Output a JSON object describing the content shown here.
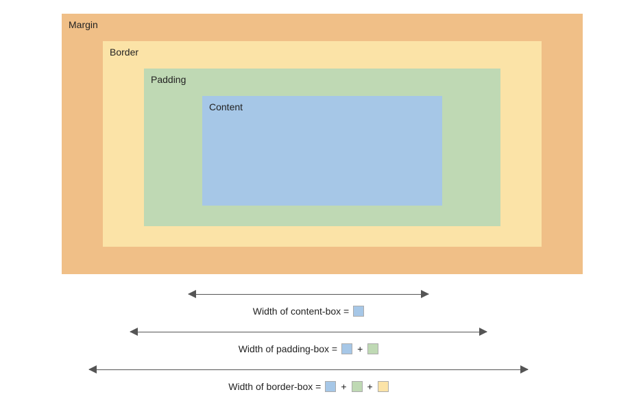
{
  "box_model": {
    "margin_label": "Margin",
    "border_label": "Border",
    "padding_label": "Padding",
    "content_label": "Content"
  },
  "legends": {
    "content_box": {
      "prefix": "Width of content-box = "
    },
    "padding_box": {
      "prefix": "Width of padding-box = ",
      "plus": "+"
    },
    "border_box": {
      "prefix": "Width of border-box = ",
      "plus1": "+",
      "plus2": "+"
    }
  },
  "colors": {
    "margin": "#f0bf87",
    "border": "#fbe3a7",
    "padding": "#bfd9b4",
    "content": "#a6c7e7"
  }
}
